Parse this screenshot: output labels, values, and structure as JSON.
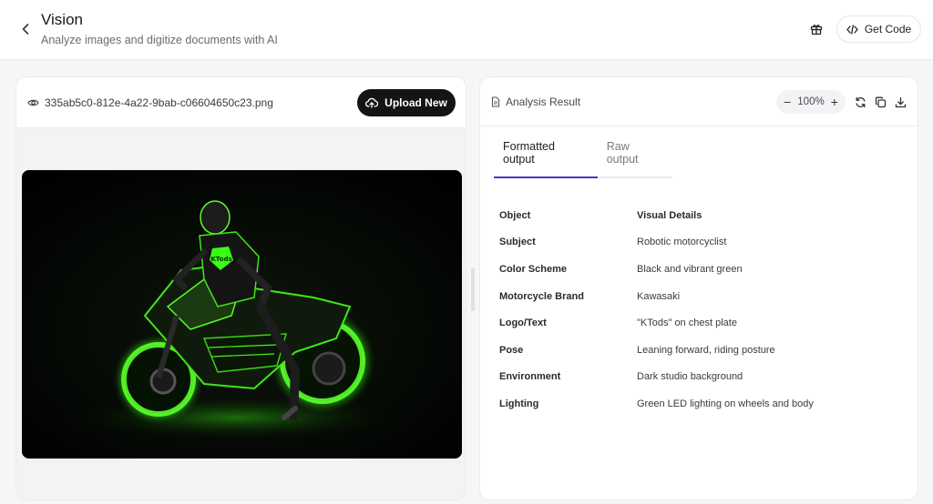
{
  "header": {
    "title": "Vision",
    "subtitle": "Analyze images and digitize documents with AI",
    "get_code_label": "Get Code"
  },
  "left_panel": {
    "file_name": "335ab5c0-812e-4a22-9bab-c06604650c23.png",
    "upload_label": "Upload New"
  },
  "right_panel": {
    "result_label": "Analysis Result",
    "zoom_level": "100%",
    "tabs": [
      {
        "label": "Formatted output",
        "active": true
      },
      {
        "label": "Raw output",
        "active": false
      }
    ],
    "table": {
      "headers": [
        "Object",
        "Visual Details"
      ],
      "rows": [
        [
          "Subject",
          "Robotic motorcyclist"
        ],
        [
          "Color Scheme",
          "Black and vibrant green"
        ],
        [
          "Motorcycle Brand",
          "Kawasaki"
        ],
        [
          "Logo/Text",
          "\"KTods\" on chest plate"
        ],
        [
          "Pose",
          "Leaning forward, riding posture"
        ],
        [
          "Environment",
          "Dark studio background"
        ],
        [
          "Lighting",
          "Green LED lighting on wheels and body"
        ]
      ]
    }
  },
  "image_text": {
    "chest_logo": "KTods"
  },
  "colors": {
    "accent": "#4338ca",
    "primary_button": "#141416",
    "neon_green": "#39ff14"
  }
}
